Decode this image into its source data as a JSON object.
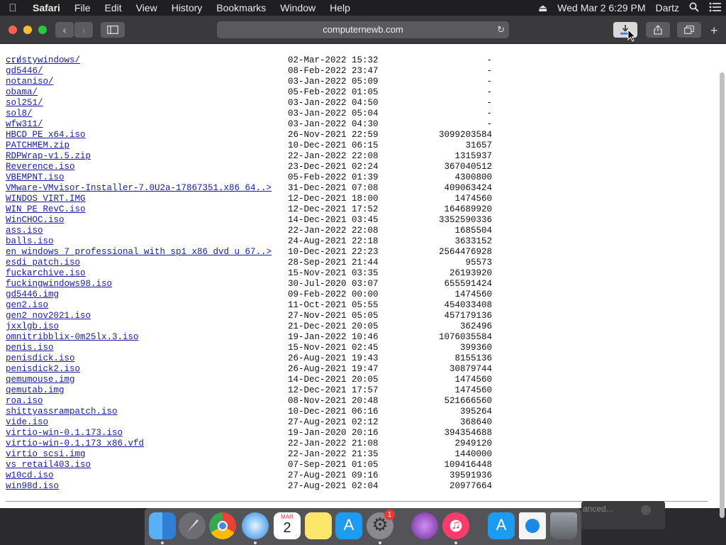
{
  "menubar": {
    "app_name": "Safari",
    "items": [
      "File",
      "Edit",
      "View",
      "History",
      "Bookmarks",
      "Window",
      "Help"
    ],
    "clock": "Wed Mar 2  6:29 PM",
    "user": "Dartz"
  },
  "toolbar": {
    "address": "computernewb.com"
  },
  "listing": {
    "parent_link": "../",
    "rows": [
      {
        "name": "crustywindows/",
        "date": "02-Mar-2022 15:32",
        "size": "-"
      },
      {
        "name": "gd5446/",
        "date": "08-Feb-2022 23:47",
        "size": "-"
      },
      {
        "name": "notaniso/",
        "date": "03-Jan-2022 05:09",
        "size": "-"
      },
      {
        "name": "obama/",
        "date": "05-Feb-2022 01:05",
        "size": "-"
      },
      {
        "name": "sol251/",
        "date": "03-Jan-2022 04:50",
        "size": "-"
      },
      {
        "name": "sol8/",
        "date": "03-Jan-2022 05:04",
        "size": "-"
      },
      {
        "name": "wfw311/",
        "date": "03-Jan-2022 04:30",
        "size": "-"
      },
      {
        "name": "HBCD_PE_x64.iso",
        "date": "26-Nov-2021 22:59",
        "size": "3099203584"
      },
      {
        "name": "PATCHMEM.zip",
        "date": "10-Dec-2021 06:15",
        "size": "31657"
      },
      {
        "name": "RDPWrap-v1.5.zip",
        "date": "22-Jan-2022 22:08",
        "size": "1315937"
      },
      {
        "name": "Reverence.iso",
        "date": "23-Dec-2021 02:24",
        "size": "367040512"
      },
      {
        "name": "VBEMPNT.iso",
        "date": "05-Feb-2022 01:39",
        "size": "4300800"
      },
      {
        "name": "VMware-VMvisor-Installer-7.0U2a-17867351.x86_64..>",
        "date": "31-Dec-2021 07:08",
        "size": "409063424"
      },
      {
        "name": "WINDOS_VIRT.IMG",
        "date": "12-Dec-2021 18:00",
        "size": "1474560"
      },
      {
        "name": "WIN_PE_RevC.iso",
        "date": "12-Dec-2021 17:52",
        "size": "164689920"
      },
      {
        "name": "WinCHOC.iso",
        "date": "14-Dec-2021 03:45",
        "size": "3352590336"
      },
      {
        "name": "ass.iso",
        "date": "22-Jan-2022 22:08",
        "size": "1685504"
      },
      {
        "name": "balls.iso",
        "date": "24-Aug-2021 22:18",
        "size": "3633152"
      },
      {
        "name": "en_windows_7_professional_with_sp1_x86_dvd_u_67..>",
        "date": "10-Dec-2021 22:23",
        "size": "2564476928"
      },
      {
        "name": "esdi_patch.iso",
        "date": "28-Sep-2021 21:44",
        "size": "95573"
      },
      {
        "name": "fuckarchive.iso",
        "date": "15-Nov-2021 03:35",
        "size": "26193920"
      },
      {
        "name": "fuckingwindows98.iso",
        "date": "30-Jul-2020 03:07",
        "size": "655591424"
      },
      {
        "name": "gd5446.img",
        "date": "09-Feb-2022 00:00",
        "size": "1474560"
      },
      {
        "name": "gen2.iso",
        "date": "11-Oct-2021 05:55",
        "size": "454033408"
      },
      {
        "name": "gen2_nov2021.iso",
        "date": "27-Nov-2021 05:05",
        "size": "457179136"
      },
      {
        "name": "jxxlgb.iso",
        "date": "21-Dec-2021 20:05",
        "size": "362496"
      },
      {
        "name": "omnitribblix-0m25lx.3.iso",
        "date": "19-Jan-2022 10:46",
        "size": "1076035584"
      },
      {
        "name": "penis.iso",
        "date": "15-Nov-2021 02:45",
        "size": "399360"
      },
      {
        "name": "penisdick.iso",
        "date": "26-Aug-2021 19:43",
        "size": "8155136"
      },
      {
        "name": "penisdick2.iso",
        "date": "26-Aug-2021 19:47",
        "size": "30879744"
      },
      {
        "name": "qemumouse.img",
        "date": "14-Dec-2021 20:05",
        "size": "1474560"
      },
      {
        "name": "qemutab.img",
        "date": "12-Dec-2021 17:57",
        "size": "1474560"
      },
      {
        "name": "roa.iso",
        "date": "08-Nov-2021 20:48",
        "size": "521666560"
      },
      {
        "name": "shittyassrampatch.iso",
        "date": "10-Dec-2021 06:16",
        "size": "395264"
      },
      {
        "name": "vide.iso",
        "date": "27-Aug-2021 02:12",
        "size": "368640"
      },
      {
        "name": "virtio-win-0.1.173.iso",
        "date": "19-Jan-2020 20:16",
        "size": "394354688"
      },
      {
        "name": "virtio-win-0.1.173_x86.vfd",
        "date": "22-Jan-2022 21:08",
        "size": "2949120"
      },
      {
        "name": "virtio_scsi.img",
        "date": "22-Jan-2022 21:35",
        "size": "1440000"
      },
      {
        "name": "vs_retail403.iso",
        "date": "07-Sep-2021 01:05",
        "size": "109416448"
      },
      {
        "name": "w10cd.iso",
        "date": "27-Aug-2021 09:16",
        "size": "39591936"
      },
      {
        "name": "win98d.iso",
        "date": "27-Aug-2021 02:04",
        "size": "20977664"
      }
    ]
  },
  "dock": {
    "badge_count": "1",
    "calendar_month": "MAR",
    "calendar_day": "2",
    "ghost_text": "anced..."
  }
}
